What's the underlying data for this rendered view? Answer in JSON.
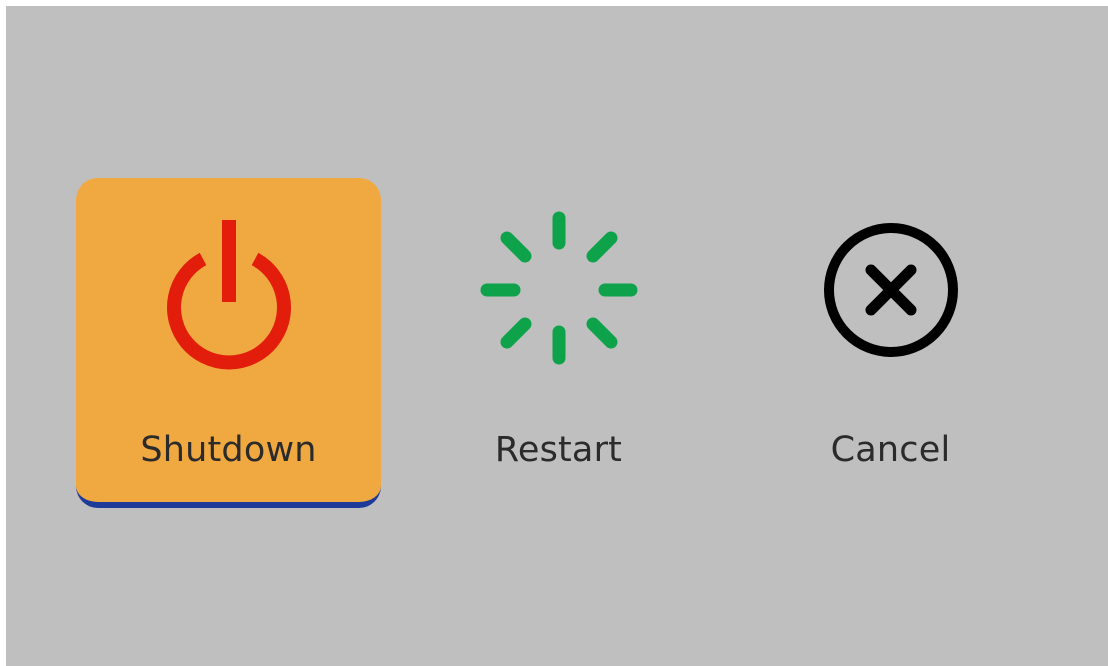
{
  "dialog": {
    "options": [
      {
        "label": "Shutdown",
        "icon": "power-icon",
        "selected": true
      },
      {
        "label": "Restart",
        "icon": "spinner-icon",
        "selected": false
      },
      {
        "label": "Cancel",
        "icon": "close-circle-icon",
        "selected": false
      }
    ]
  },
  "colors": {
    "background": "#bfbfbf",
    "selected_fill": "#f0a940",
    "selected_underline": "#1f3b9a",
    "power_icon": "#e21d0b",
    "restart_icon": "#0ea34a",
    "cancel_icon": "#000000",
    "label_text": "#2b2b2b"
  }
}
